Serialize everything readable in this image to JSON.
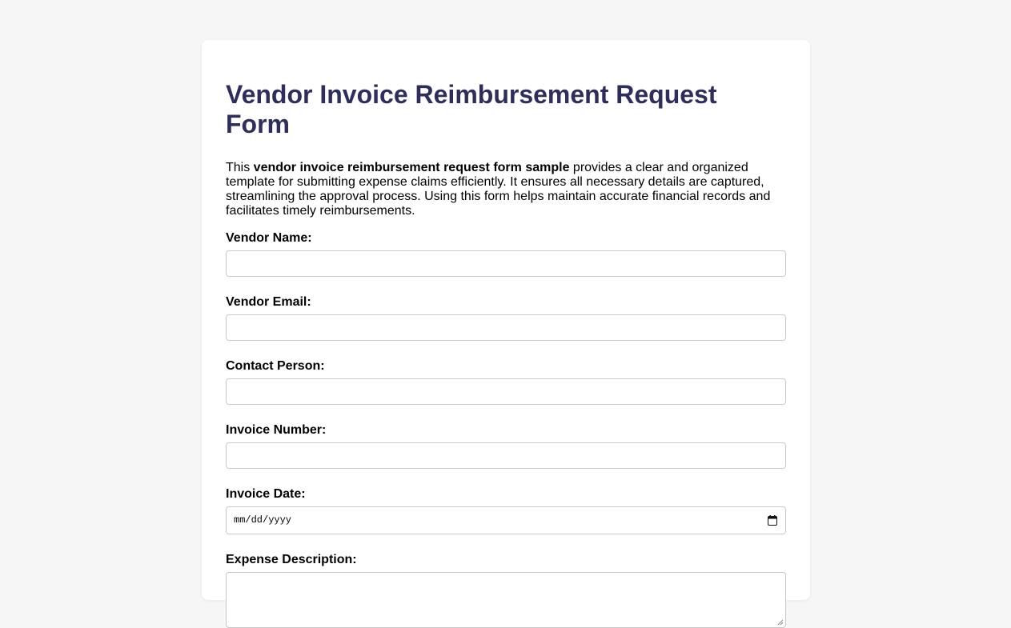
{
  "form": {
    "title": "Vendor Invoice Reimbursement Request Form",
    "intro": {
      "prefix": "This ",
      "bold": "vendor invoice reimbursement request form sample",
      "suffix": " provides a clear and organized template for submitting expense claims efficiently. It ensures all necessary details are captured, streamlining the approval process. Using this form helps maintain accurate financial records and facilitates timely reimbursements."
    },
    "fields": {
      "vendor_name": {
        "label": "Vendor Name:",
        "value": ""
      },
      "vendor_email": {
        "label": "Vendor Email:",
        "value": ""
      },
      "contact_person": {
        "label": "Contact Person:",
        "value": ""
      },
      "invoice_number": {
        "label": "Invoice Number:",
        "value": ""
      },
      "invoice_date": {
        "label": "Invoice Date:",
        "placeholder": "mm/dd/yyyy",
        "icon": "calendar-icon"
      },
      "expense_description": {
        "label": "Expense Description:",
        "value": ""
      }
    }
  },
  "colors": {
    "page_background": "#f6f6f6",
    "card_background": "#ffffff",
    "title": "#2e2e5e",
    "input_border": "#c8c8c8"
  }
}
